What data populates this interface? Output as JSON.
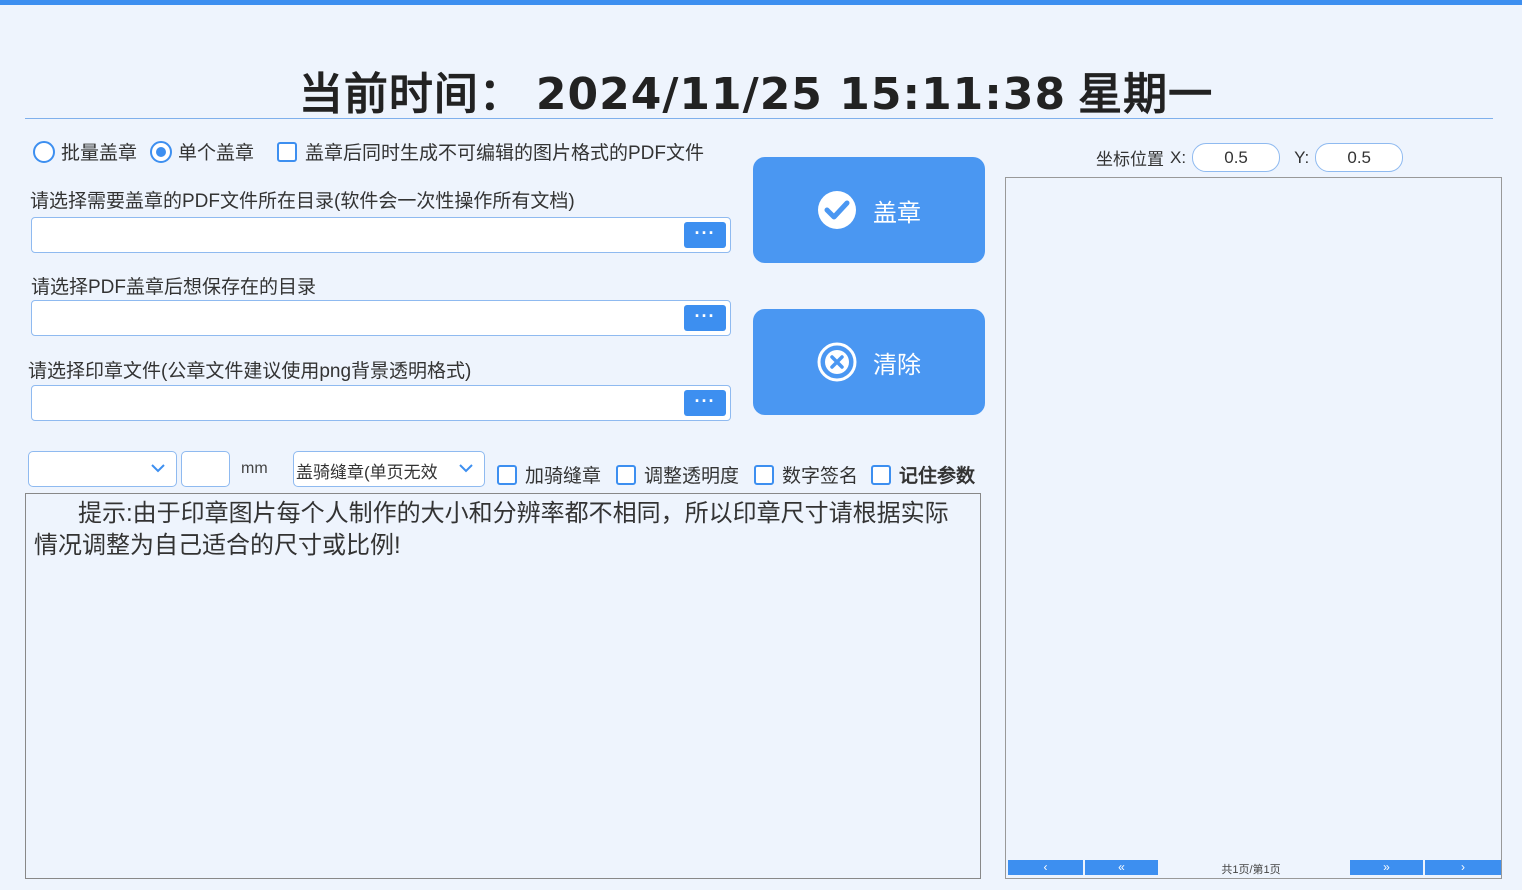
{
  "clock": {
    "prefix": "当前时间：",
    "datetime": "2024/11/25 15:11:38",
    "weekday": "星期一"
  },
  "mode": {
    "batch_label": "批量盖章",
    "single_label": "单个盖章",
    "selected": "single",
    "pdf_image_label": "盖章后同时生成不可编辑的图片格式的PDF文件",
    "pdf_image_checked": false
  },
  "fields": {
    "source_dir_label": "请选择需要盖章的PDF文件所在目录(软件会一次性操作所有文档)",
    "source_dir_value": "",
    "save_dir_label": "请选择PDF盖章后想保存在的目录",
    "save_dir_value": "",
    "stamp_file_label": "请选择印章文件(公章文件建议使用png背景透明格式)",
    "stamp_file_value": "",
    "browse_label": "···"
  },
  "actions": {
    "stamp_label": "盖章",
    "clear_label": "清除"
  },
  "coordinates": {
    "label": "坐标位置",
    "x_label": "X:",
    "x_value": "0.5",
    "y_label": "Y:",
    "y_value": "0.5"
  },
  "options": {
    "size_value": "",
    "size_number": "",
    "unit": "mm",
    "seam_mode": "盖骑缝章(单页无效",
    "seam_label": "加骑缝章",
    "opacity_label": "调整透明度",
    "signature_label": "数字签名",
    "remember_label": "记住参数"
  },
  "tip": {
    "line1": "提示:由于印章图片每个人制作的大小和分辨率都不相同，所以印章尺寸请根据实际",
    "line2": "情况调整为自己适合的尺寸或比例!"
  },
  "pager": {
    "prev_label": "‹",
    "first_label": "«",
    "page_text": "共1页/第1页",
    "last_label": "»",
    "next_label": "›"
  },
  "colors": {
    "accent": "#3d8ff0",
    "button": "#4a97f2",
    "background": "#eef4fd"
  }
}
